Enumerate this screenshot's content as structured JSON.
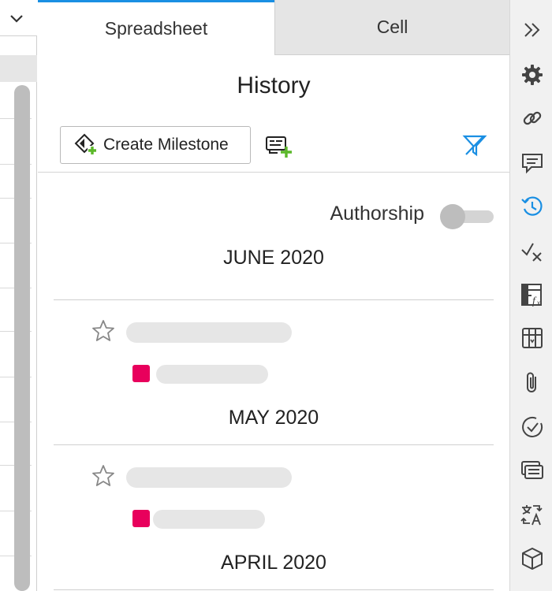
{
  "tabs": [
    {
      "label": "Spreadsheet",
      "active": true
    },
    {
      "label": "Cell",
      "active": false
    }
  ],
  "panel": {
    "title": "History",
    "create_milestone_label": "Create Milestone",
    "authorship_label": "Authorship",
    "authorship_on": false
  },
  "months": [
    {
      "label": "JUNE 2020",
      "author_color": "#e8005c"
    },
    {
      "label": "MAY 2020",
      "author_color": "#e8005c"
    },
    {
      "label": "APRIL 2020",
      "author_color": "#e8005c"
    }
  ],
  "colors": {
    "accent": "#1a8fe3",
    "author_chip": "#e8005c",
    "add_green": "#5cb82a"
  },
  "rail_icons": [
    "collapse-panel-icon",
    "gear-icon",
    "link-icon",
    "comment-icon",
    "history-icon",
    "check-cross-icon",
    "formula-icon",
    "table-icon",
    "paperclip-icon",
    "checkmark-circle-icon",
    "list-icon",
    "translate-icon",
    "cube-icon"
  ]
}
